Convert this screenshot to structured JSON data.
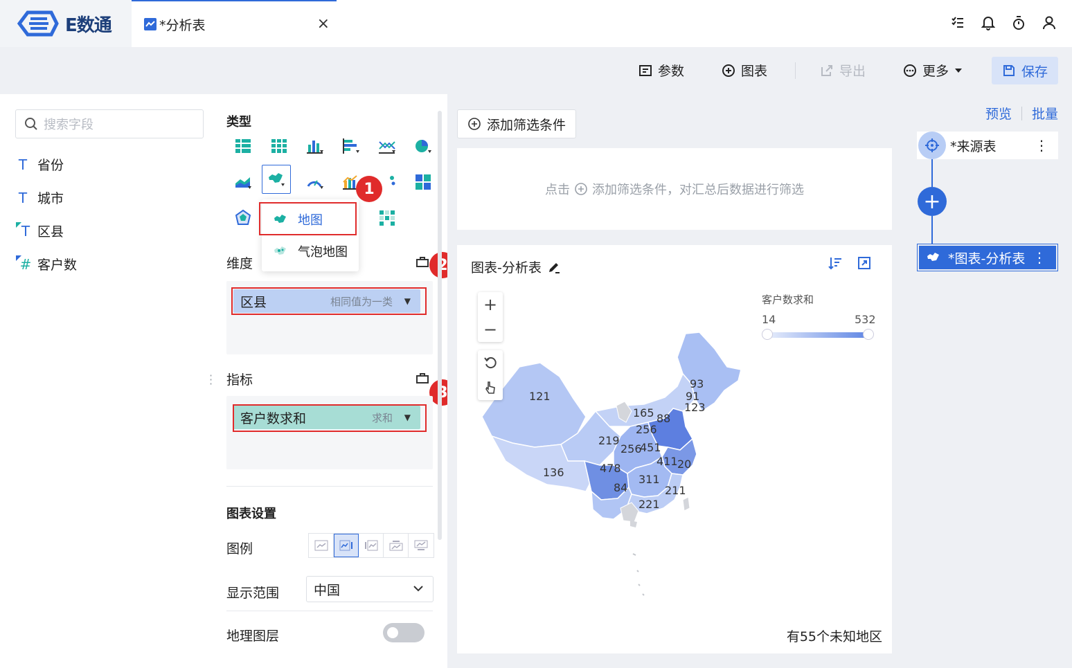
{
  "app": {
    "brand": "E数通"
  },
  "tab": {
    "title": "*分析表",
    "close": "×"
  },
  "toolbar": {
    "params": "参数",
    "chart": "图表",
    "export": "导出",
    "more": "更多",
    "save": "保存"
  },
  "fields": {
    "search_placeholder": "搜索字段",
    "items": [
      {
        "type": "T",
        "label": "省份"
      },
      {
        "type": "T",
        "label": "城市"
      },
      {
        "type": "T",
        "label": "区县"
      },
      {
        "type": "#",
        "label": "客户数"
      }
    ]
  },
  "config": {
    "type_title": "类型",
    "chart_type_menu": [
      "地图",
      "气泡地图"
    ],
    "dimension_title": "维度",
    "dimension_pill": {
      "label": "区县",
      "sub": "相同值为一类"
    },
    "metric_title": "指标",
    "metric_pill": {
      "label": "客户数求和",
      "sub": "求和"
    },
    "settings_title": "图表设置",
    "legend_label": "图例",
    "range_label": "显示范围",
    "range_value": "中国",
    "geo_layer_label": "地理图层"
  },
  "badges": [
    "1",
    "2",
    "3"
  ],
  "filter": {
    "add_button": "添加筛选条件",
    "hint_prefix": "点击",
    "hint_suffix": "添加筛选条件，对汇总后数据进行筛选"
  },
  "chart": {
    "title": "图表-分析表",
    "legend_title": "客户数求和",
    "legend_min": "14",
    "legend_max": "532",
    "unknown_text": "有55个未知地区",
    "map_labels": [
      "121",
      "93",
      "91",
      "123",
      "165",
      "88",
      "256",
      "219",
      "256",
      "451",
      "411",
      "20",
      "478",
      "136",
      "311",
      "84",
      "211",
      "221"
    ]
  },
  "right": {
    "preview": "预览",
    "batch": "批量",
    "source_node": "*来源表",
    "chart_node": "*图表-分析表"
  },
  "colors": {
    "accent": "#2f6ad9",
    "badge": "#e02b2b",
    "dimension_pill": "#bcd0f3",
    "metric_pill": "#a7ddd5"
  }
}
